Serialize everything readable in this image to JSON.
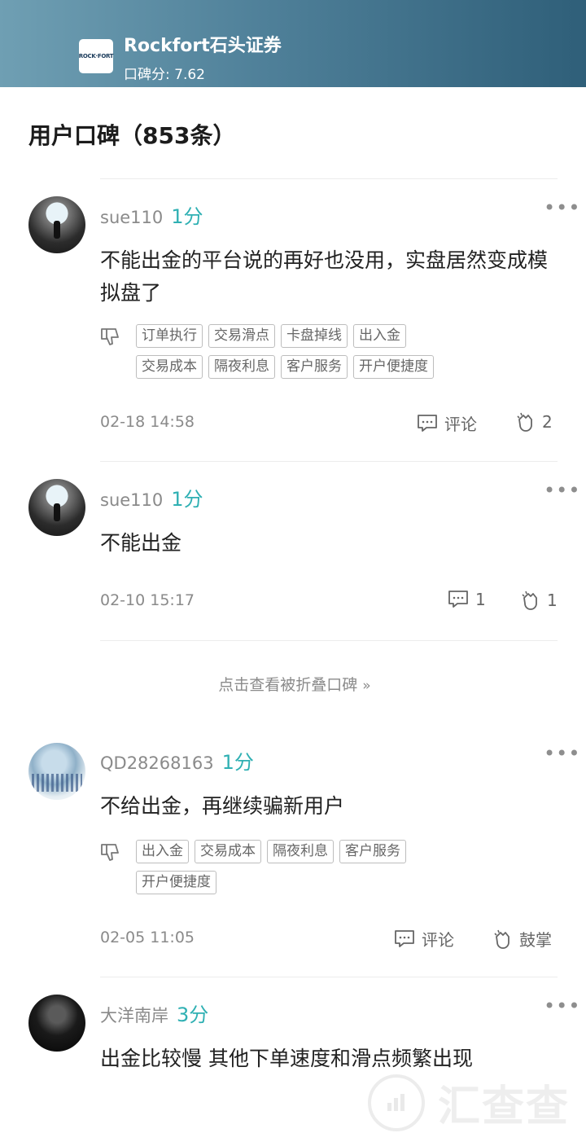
{
  "header": {
    "logo_text": "ROCK·FORT",
    "broker_name": "Rockfort石头证券",
    "score_label": "口碑分: 7.62"
  },
  "section": {
    "title": "用户口碑（853条）"
  },
  "reviews": [
    {
      "user": "sue110",
      "score": "1分",
      "text": "不能出金的平台说的再好也没用，实盘居然变成模拟盘了",
      "tags": [
        "订单执行",
        "交易滑点",
        "卡盘掉线",
        "出入金",
        "交易成本",
        "隔夜利息",
        "客户服务",
        "开户便捷度"
      ],
      "time": "02-18 14:58",
      "comment_label": "评论",
      "clap_label": "2"
    },
    {
      "user": "sue110",
      "score": "1分",
      "text": "不能出金",
      "tags": [],
      "time": "02-10 15:17",
      "comment_label": "1",
      "clap_label": "1"
    },
    {
      "user": "QD28268163",
      "score": "1分",
      "text": "不给出金，再继续骗新用户",
      "tags": [
        "出入金",
        "交易成本",
        "隔夜利息",
        "客户服务",
        "开户便捷度"
      ],
      "time": "02-05 11:05",
      "comment_label": "评论",
      "clap_label": "鼓掌"
    },
    {
      "user": "大洋南岸",
      "score": "3分",
      "text": "出金比较慢 其他下单速度和滑点频繁出现"
    }
  ],
  "folded_link": "点击查看被折叠口碑",
  "watermark": "汇查查",
  "icons": {
    "more": "more-icon",
    "dislike": "thumbs-down-icon",
    "comment": "comment-icon",
    "clap": "clap-icon",
    "chevron": "double-chevron-right-icon"
  },
  "colors": {
    "score": "#2fb0b3",
    "header_start": "#6f9fb3",
    "header_end": "#2f5f79"
  }
}
